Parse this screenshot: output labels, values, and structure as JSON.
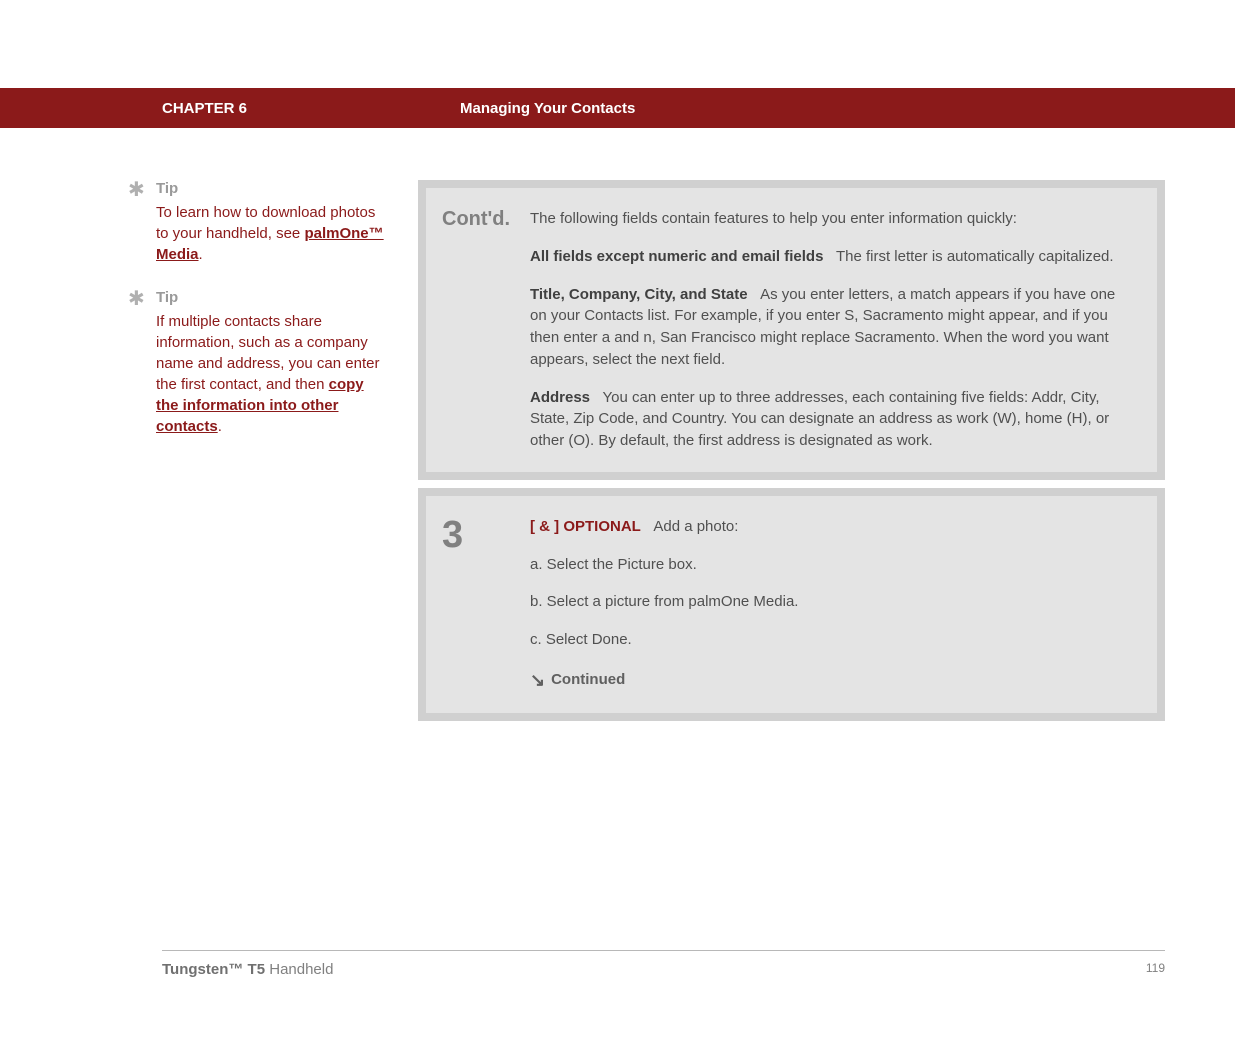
{
  "header": {
    "chapter": "CHAPTER 6",
    "title": "Managing Your Contacts"
  },
  "sidebar": {
    "tips": [
      {
        "label": "Tip",
        "pre": "To learn how to download photos to your handheld, see ",
        "link": "palmOne™ Media",
        "post": "."
      },
      {
        "label": "Tip",
        "pre": "If multiple contacts share information, such as a company name and address, you can enter the first contact, and then ",
        "link": "copy the information into other contacts",
        "post": "."
      }
    ]
  },
  "panels": {
    "contd": {
      "label": "Cont'd.",
      "intro": "The following fields contain features to help you enter information quickly:",
      "items": [
        {
          "term": "All fields except numeric and email fields",
          "desc": "The first letter is automatically capitalized."
        },
        {
          "term": "Title, Company, City, and State",
          "desc": "As you enter letters, a match appears if you have one on your Contacts list. For example, if you enter S, Sacramento might appear, and if you then enter a and n, San Francisco might replace Sacramento. When the word you want appears, select the next field."
        },
        {
          "term": "Address",
          "desc": "You can enter up to three addresses, each containing five fields: Addr, City, State, Zip Code, and Country. You can designate an address as work (W), home (H), or other (O). By default, the first address is designated as work."
        }
      ]
    },
    "step3": {
      "num": "3",
      "optional_prefix": "[ & ]  OPTIONAL",
      "optional_text": "Add a photo:",
      "steps": [
        "a.  Select the Picture box.",
        "b.  Select a picture from palmOne Media.",
        "c.  Select Done."
      ],
      "continued": "Continued"
    }
  },
  "footer": {
    "product_bold": "Tungsten™ T5",
    "product_rest": " Handheld",
    "page": "119"
  }
}
